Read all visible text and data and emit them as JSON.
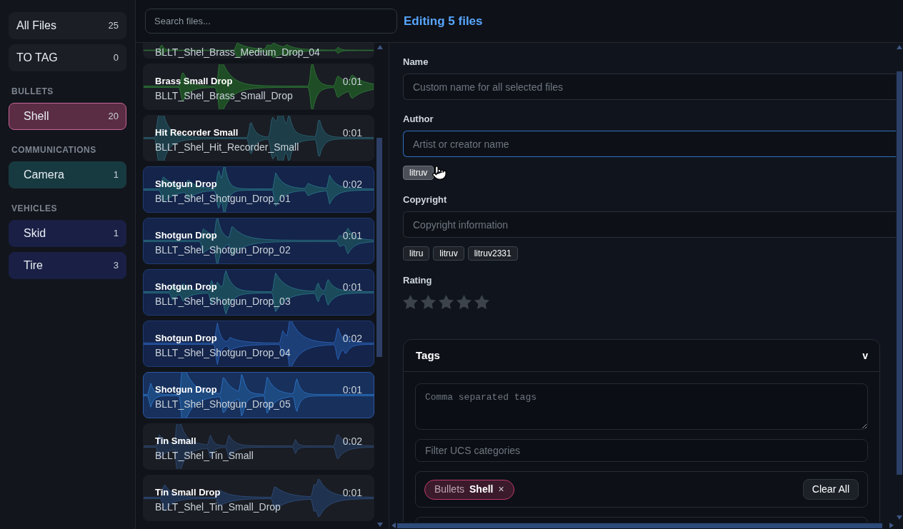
{
  "sidebar": {
    "items": [
      {
        "label": "All Files",
        "count": "25",
        "selected": false
      },
      {
        "label": "TO TAG",
        "count": "0",
        "selected": false
      }
    ],
    "groups": [
      {
        "title": "BULLETS",
        "items": [
          {
            "label": "Shell",
            "count": "20",
            "color": "#5a2d45",
            "selected": true
          }
        ]
      },
      {
        "title": "COMMUNICATIONS",
        "items": [
          {
            "label": "Camera",
            "count": "1",
            "color": "#173a40",
            "selected": false
          }
        ]
      },
      {
        "title": "VEHICLES",
        "items": [
          {
            "label": "Skid",
            "count": "1",
            "color": "#1a1f45",
            "selected": false
          },
          {
            "label": "Tire",
            "count": "3",
            "color": "#1a1f45",
            "selected": false
          }
        ]
      }
    ]
  },
  "search": {
    "placeholder": "Search files..."
  },
  "files": [
    {
      "filename": "BLLT_Shel_Brass_Medium_Drop_04",
      "color": "#1f4d25",
      "selected": false,
      "focused": false
    },
    {
      "title": "Brass Small Drop",
      "duration": "0:01",
      "filename": "BLLT_Shel_Brass_Small_Drop",
      "color": "#1f4d25",
      "selected": false,
      "focused": false
    },
    {
      "title": "Hit Recorder Small",
      "duration": "0:01",
      "filename": "BLLT_Shel_Hit_Recorder_Small",
      "color": "#1d3d48",
      "selected": false,
      "focused": false
    },
    {
      "title": "Shotgun Drop",
      "duration": "0:02",
      "filename": "BLLT_Shel_Shotgun_Drop_01",
      "color": "#1b4a5a",
      "selected": true,
      "focused": false
    },
    {
      "title": "Shotgun Drop",
      "duration": "0:01",
      "filename": "BLLT_Shel_Shotgun_Drop_02",
      "color": "#1b4658",
      "selected": true,
      "focused": false
    },
    {
      "title": "Shotgun Drop",
      "duration": "0:01",
      "filename": "BLLT_Shel_Shotgun_Drop_03",
      "color": "#1b4a5a",
      "selected": true,
      "focused": false
    },
    {
      "title": "Shotgun Drop",
      "duration": "0:02",
      "filename": "BLLT_Shel_Shotgun_Drop_04",
      "color": "#1c3f78",
      "selected": true,
      "focused": false
    },
    {
      "title": "Shotgun Drop",
      "duration": "0:01",
      "filename": "BLLT_Shel_Shotgun_Drop_05",
      "color": "#1d4a80",
      "selected": true,
      "focused": true
    },
    {
      "title": "Tin Small",
      "duration": "0:02",
      "filename": "BLLT_Shel_Tin_Small",
      "color": "#1f2f48",
      "selected": false,
      "focused": false
    },
    {
      "title": "Tin Small Drop",
      "duration": "0:01",
      "filename": "BLLT_Shel_Tin_Small_Drop",
      "color": "#1f3250",
      "selected": false,
      "focused": false
    }
  ],
  "editor": {
    "title": "Editing 5 files",
    "fields": [
      {
        "label": "Name",
        "placeholder": "Custom name for all selected files",
        "focused": false
      },
      {
        "label": "Author",
        "placeholder": "Artist or creator name",
        "focused": true,
        "suggestions": [
          {
            "label": "litruv",
            "hovered": true
          }
        ]
      },
      {
        "label": "Copyright",
        "placeholder": "Copyright information",
        "focused": false,
        "suggestions": [
          {
            "label": "litru",
            "hovered": false
          },
          {
            "label": "litruv",
            "hovered": false
          },
          {
            "label": "litruv2331",
            "hovered": false
          }
        ]
      }
    ],
    "rating": {
      "label": "Rating",
      "stars": 0
    },
    "tags": {
      "title": "Tags",
      "toggle": "v",
      "expanded": true,
      "tags_input": {
        "placeholder": "Comma separated tags"
      },
      "filter": {
        "placeholder": "Filter UCS categories"
      },
      "selected_categories": [
        {
          "category": "Bullets",
          "subcategory": "Shell",
          "remove": "×"
        }
      ],
      "clear_button": "Clear All"
    }
  }
}
